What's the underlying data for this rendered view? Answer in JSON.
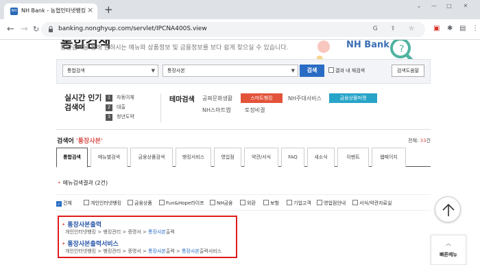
{
  "browser": {
    "tab_title": "NH Bank - 농협인터넷뱅킹",
    "favicon_text": "NH",
    "tab_close": "×",
    "new_tab": "+",
    "url": "banking.nonghyup.com/servlet/IPCNA400S.view",
    "window_controls": [
      "⌄",
      "—",
      "□",
      "✕"
    ]
  },
  "hero": {
    "title": "통합검색",
    "description": "통합검색을 통해 원하시는 메뉴와 상품정보 및 금융정보를 보다 쉽게 찾으실 수 있습니다.",
    "logo": "NH Bank"
  },
  "search": {
    "scope_value": "통합검색",
    "keyword_value": "통장사본",
    "search_label": "검색",
    "within_results_label": "결과 내 재검색",
    "help_label": "검색도움말"
  },
  "realtime": {
    "title_line1": "실시간 인기",
    "title_line2": "검색어",
    "items": [
      {
        "rank": "1",
        "label": "자동이체"
      },
      {
        "rank": "2",
        "label": "대출"
      },
      {
        "rank": "3",
        "label": "청년도약"
      }
    ]
  },
  "theme": {
    "title": "테마검색",
    "items": [
      "공짜문화생활",
      "스마트뱅킹",
      "NH주대서비스",
      "금융상품마켓",
      "NH스마트앱",
      "토정비결"
    ]
  },
  "results": {
    "label": "검색어",
    "keyword": "'통장사본'",
    "total_label": "전체:",
    "total_count": "33",
    "total_unit": "건"
  },
  "tabs": [
    "통합검색",
    "메뉴별검색",
    "금융상품검색",
    "뱅킹서비스",
    "영업점",
    "약관/서식",
    "FAQ",
    "새소식",
    "이벤트",
    "웹페이지"
  ],
  "menu_section": {
    "title": "메뉴검색결과",
    "count": "(2건)"
  },
  "filters": [
    "건체",
    "개인인터넷뱅킹",
    "금융상품",
    "Fun&Hope라이프",
    "NH금융",
    "외환",
    "보험",
    "기업고객",
    "영업점안내",
    "서식/약관자료실"
  ],
  "result_items": [
    {
      "title_keyword": "통장사본",
      "title_rest": "출력",
      "path_prefix": "개인인터넷뱅킹 > 뱅킹관리 > 증명서 > ",
      "path_keyword": "통장사본",
      "path_rest": "출력"
    },
    {
      "title_keyword": "통장사본",
      "title_rest": "출력서비스",
      "path_prefix": "개인인터넷뱅킹 > 뱅킹관리 > 증명서 > ",
      "path_keyword": "통장사본",
      "path_mid": "출력 > ",
      "path_keyword2": "통장사본",
      "path_rest": "출력서비스"
    }
  ],
  "quick_menu": {
    "label": "빠른메뉴"
  },
  "colors": {
    "accent_blue": "#2a6cc4",
    "highlight_red": "#e01b1b",
    "smart_banking": "#e3533a",
    "product_market": "#27a4c8"
  }
}
